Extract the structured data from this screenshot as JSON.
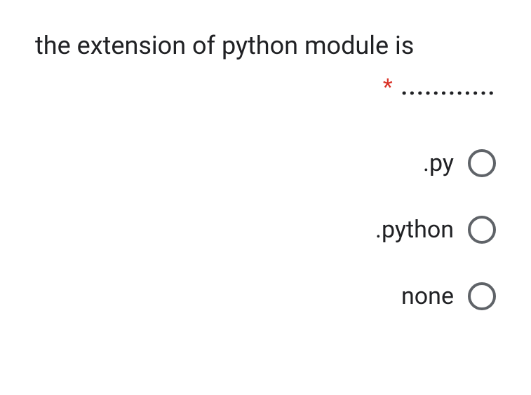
{
  "question": {
    "text": "the extension of python module is",
    "required_mark": "*",
    "blank_line": "............"
  },
  "options": [
    {
      "label": ".py"
    },
    {
      "label": ".python"
    },
    {
      "label": "none"
    }
  ]
}
